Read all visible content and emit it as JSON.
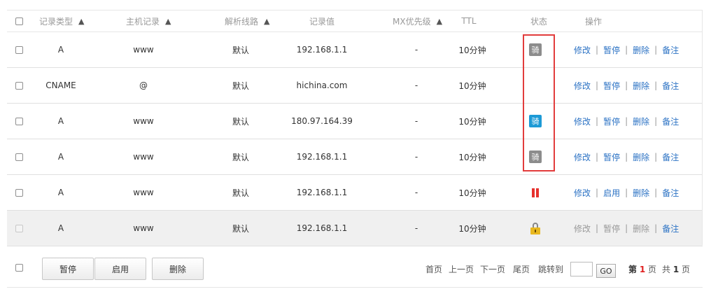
{
  "header": {
    "type": "记录类型",
    "host": "主机记录",
    "line": "解析线路",
    "value": "记录值",
    "mx": "MX优先级",
    "ttl": "TTL",
    "status": "状态",
    "ops": "操作",
    "sort_icon": "▲"
  },
  "rows": [
    {
      "type": "A",
      "host": "www",
      "line": "默认",
      "value": "192.168.1.1",
      "mx": "-",
      "ttl": "10分钟",
      "status": "骑",
      "status_icon": "gray-badge",
      "ops": [
        "修改",
        "暂停",
        "删除",
        "备注"
      ]
    },
    {
      "type": "CNAME",
      "host": "@",
      "line": "默认",
      "value": "hichina.com",
      "mx": "-",
      "ttl": "10分钟",
      "status": "",
      "status_icon": "none",
      "ops": [
        "修改",
        "暂停",
        "删除",
        "备注"
      ]
    },
    {
      "type": "A",
      "host": "www",
      "line": "默认",
      "value": "180.97.164.39",
      "mx": "-",
      "ttl": "10分钟",
      "status": "骑",
      "status_icon": "blue-badge",
      "ops": [
        "修改",
        "暂停",
        "删除",
        "备注"
      ]
    },
    {
      "type": "A",
      "host": "www",
      "line": "默认",
      "value": "192.168.1.1",
      "mx": "-",
      "ttl": "10分钟",
      "status": "骑",
      "status_icon": "gray-badge",
      "ops": [
        "修改",
        "暂停",
        "删除",
        "备注"
      ]
    },
    {
      "type": "A",
      "host": "www",
      "line": "默认",
      "value": "192.168.1.1",
      "mx": "-",
      "ttl": "10分钟",
      "status": "",
      "status_icon": "pause-icon",
      "ops": [
        "修改",
        "启用",
        "删除",
        "备注"
      ]
    },
    {
      "type": "A",
      "host": "www",
      "line": "默认",
      "value": "192.168.1.1",
      "mx": "-",
      "ttl": "10分钟",
      "status": "",
      "status_icon": "lock-icon",
      "ops": [
        "修改",
        "暂停",
        "删除",
        "备注"
      ]
    }
  ],
  "footer": {
    "pause": "暂停",
    "enable": "启用",
    "delete": "删除",
    "first": "首页",
    "prev": "上一页",
    "next": "下一页",
    "last": "尾页",
    "jump": "跳转到",
    "go": "GO",
    "page_prefix": "第",
    "page_current": "1",
    "page_suffix": "页",
    "total_prefix": "共",
    "total": "1",
    "total_suffix": "页"
  },
  "colors": {
    "link": "#2b72c4",
    "highlight_box": "#e23c3c",
    "badge_gray": "#8c8c8c",
    "badge_blue": "#1c9ad6"
  }
}
